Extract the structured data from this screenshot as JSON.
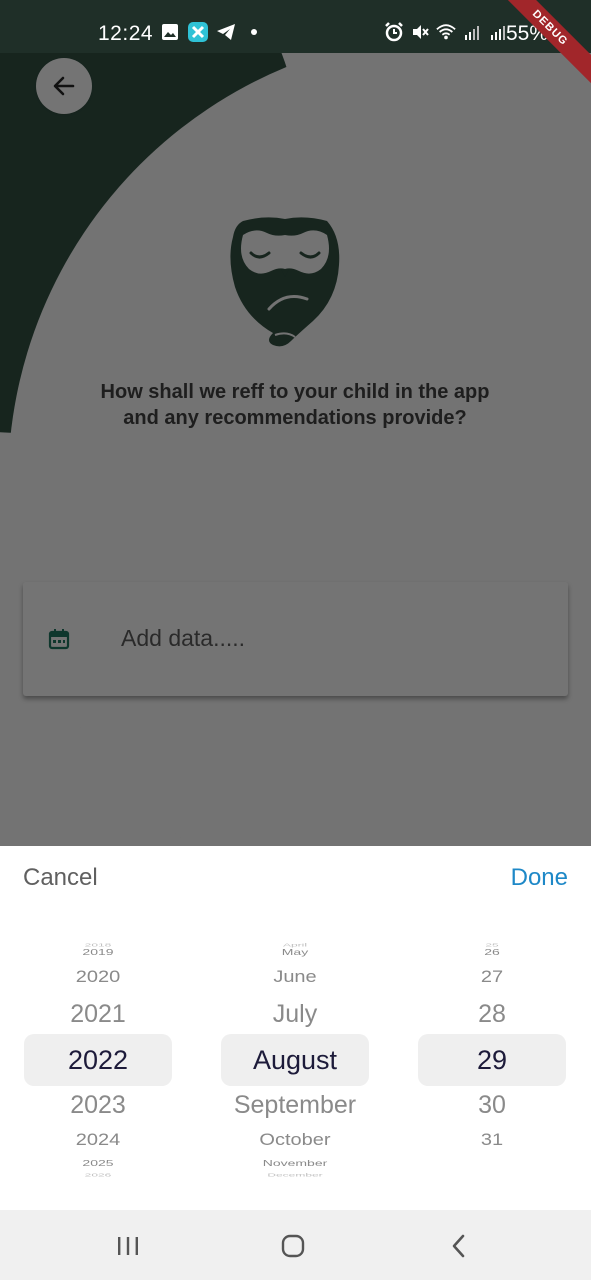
{
  "status_bar": {
    "time": "12:24",
    "battery_percent": "55%",
    "debug_label": "DEBUG"
  },
  "screen": {
    "question": "How shall we reff to your child in the app and any recommendations provide?",
    "date_field": {
      "placeholder": "Add data.....",
      "value": ""
    },
    "colors": {
      "brand_dark_green": "#2e4a3d",
      "icon_teal": "#1f6e5a"
    }
  },
  "picker": {
    "cancel_label": "Cancel",
    "done_label": "Done",
    "accent_color": "#1e88c7",
    "years": {
      "faded_top": "2018",
      "items": [
        "2019",
        "2020",
        "2021",
        "2022",
        "2023",
        "2024",
        "2025"
      ],
      "faded_bottom": "2026",
      "selected": "2022"
    },
    "months": {
      "faded_top": "April",
      "items": [
        "May",
        "June",
        "July",
        "August",
        "September",
        "October",
        "November"
      ],
      "faded_bottom": "December",
      "selected": "August"
    },
    "days": {
      "faded_top": "25",
      "items": [
        "26",
        "27",
        "28",
        "29",
        "30",
        "31"
      ],
      "selected": "29"
    }
  },
  "nav_bar": {
    "recent_apps_icon": "recent-apps-icon",
    "home_icon": "home-icon",
    "back_icon": "back-icon"
  }
}
